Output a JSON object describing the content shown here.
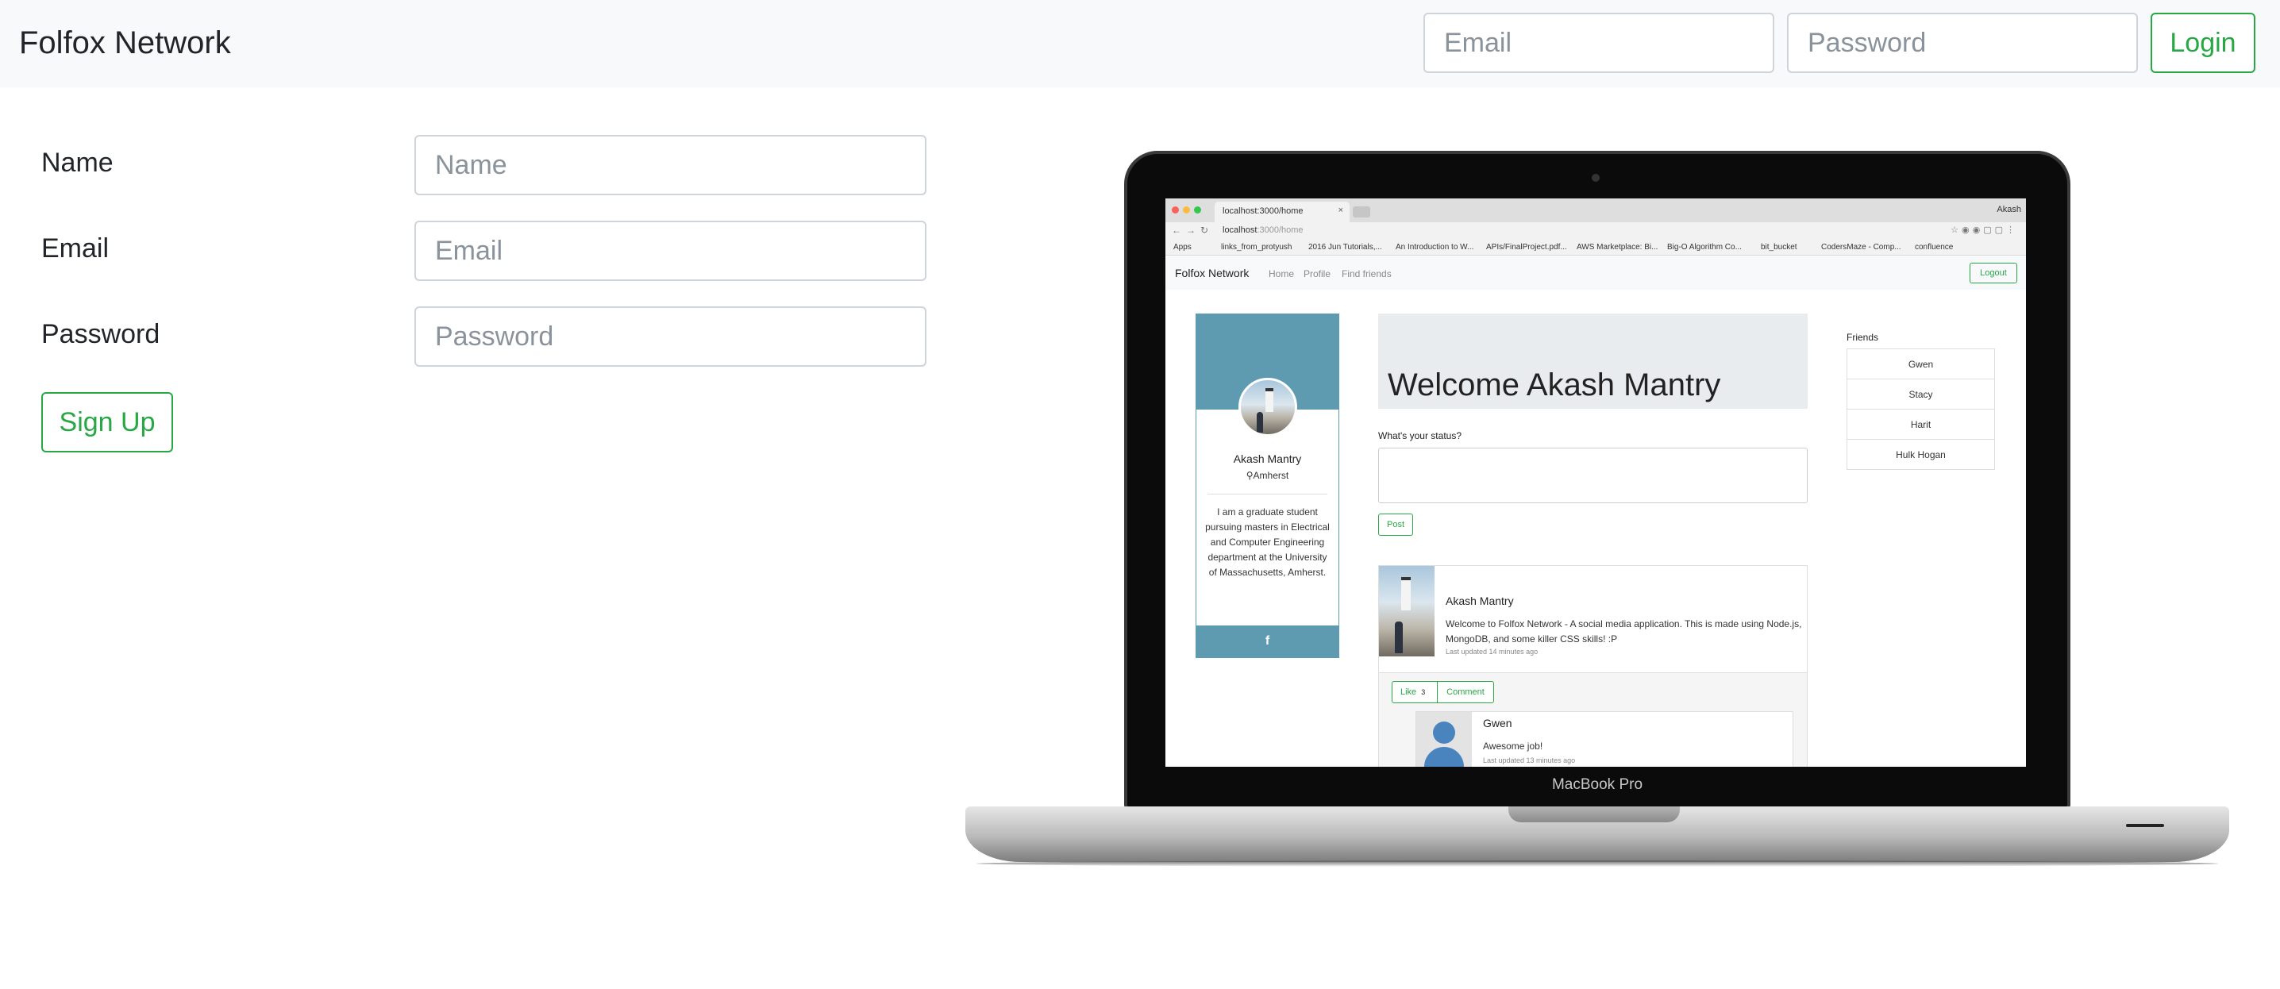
{
  "navbar": {
    "brand": "Folfox Network",
    "email_placeholder": "Email",
    "password_placeholder": "Password",
    "login_label": "Login"
  },
  "signup": {
    "name_label": "Name",
    "name_placeholder": "Name",
    "email_label": "Email",
    "email_placeholder": "Email",
    "password_label": "Password",
    "password_placeholder": "Password",
    "signup_label": "Sign Up"
  },
  "laptop": {
    "model_label": "MacBook Pro",
    "browser": {
      "tab_title": "localhost:3000/home",
      "tab_close": "×",
      "user": "Akash",
      "url_host": "localhost",
      "url_path": ":3000/home",
      "bookmarks": [
        "Apps",
        "links_from_protyush",
        "2016 Jun Tutorials,...",
        "An Introduction to W...",
        "APIs/FinalProject.pdf...",
        "AWS Marketplace: Bi...",
        "Big-O Algorithm Co...",
        "bit_bucket",
        "CodersMaze - Comp...",
        "confluence"
      ]
    },
    "app": {
      "brand": "Folfox Network",
      "nav_links": [
        "Home",
        "Profile",
        "Find friends"
      ],
      "logout_label": "Logout",
      "profile": {
        "name": "Akash Mantry",
        "location": "Amherst",
        "bio": "I am a graduate student pursuing masters in Electrical and Computer Engineering department at the University of Massachusetts, Amherst.",
        "social_icon": "f"
      },
      "welcome": "Welcome Akash Mantry",
      "status_label": "What's your status?",
      "post_label": "Post",
      "post": {
        "author": "Akash Mantry",
        "body": "Welcome to Folfox Network - A social media application. This is made using Node.js, MongoDB, and some killer CSS skills! :P",
        "time": "Last updated 14 minutes ago",
        "like_label": "Like",
        "like_count": "3",
        "comment_label": "Comment"
      },
      "comment": {
        "author": "Gwen",
        "body": "Awesome job!",
        "time": "Last updated 13 minutes ago"
      },
      "friends_title": "Friends",
      "friends": [
        "Gwen",
        "Stacy",
        "Harit",
        "Hulk Hogan"
      ]
    }
  },
  "colors": {
    "accent_green": "#28a745",
    "profile_blue": "#5e9bb1",
    "navbar_bg": "#f8f9fa"
  },
  "icons": {
    "location": "map-pin-icon",
    "facebook": "facebook-icon",
    "default_avatar": "user-silhouette-icon"
  }
}
